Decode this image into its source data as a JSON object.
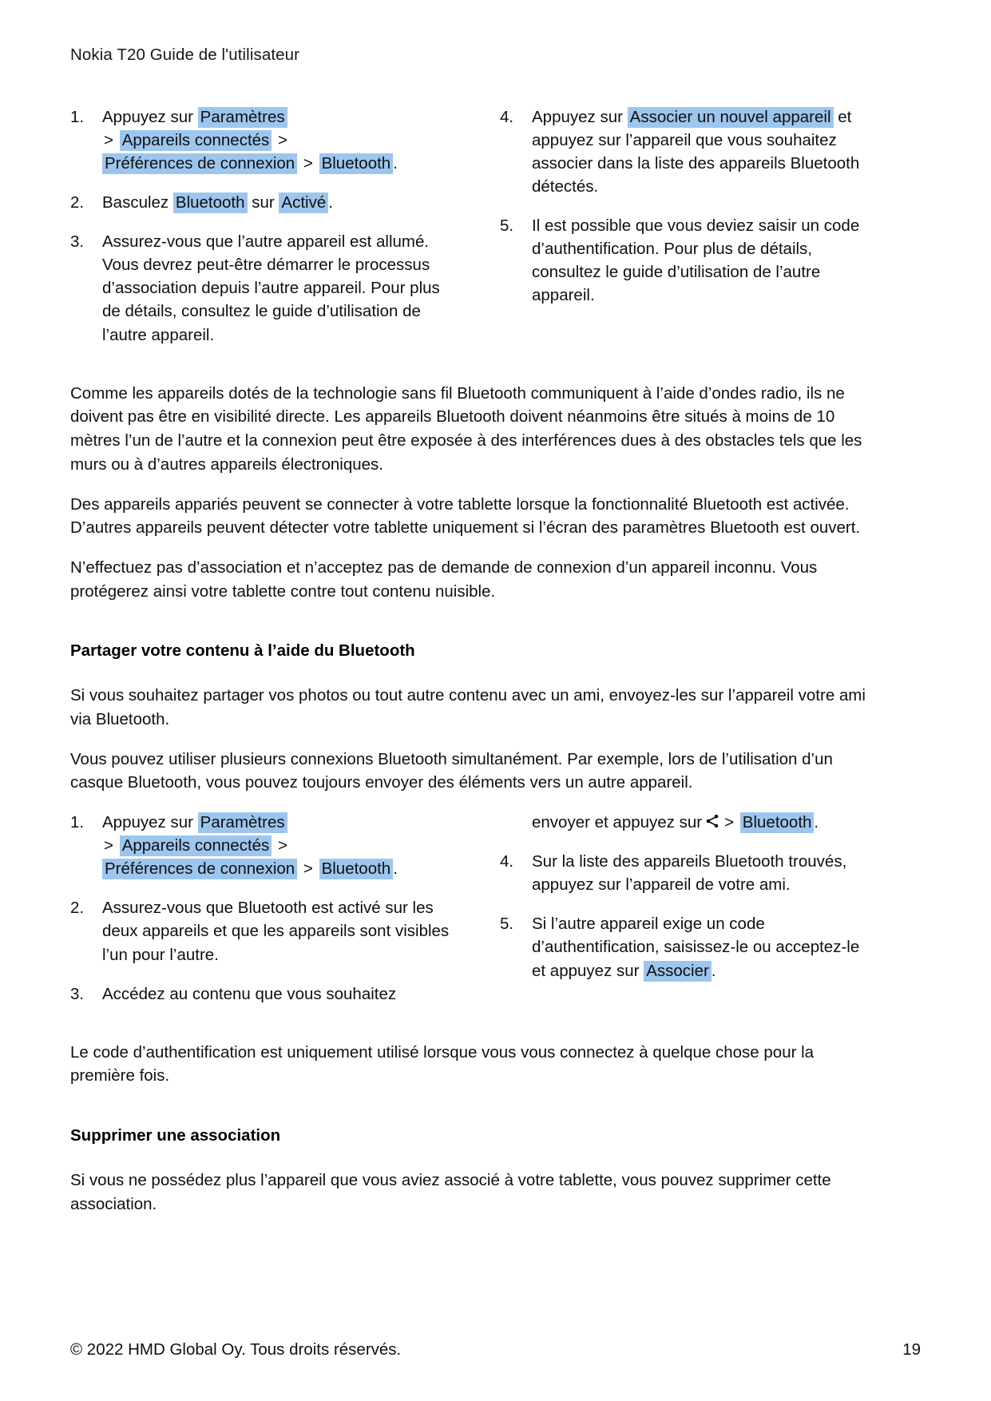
{
  "header": {
    "title": "Nokia T20 Guide de l'utilisateur"
  },
  "highlight_color": "#9dc6ee",
  "pairing_list": {
    "left": {
      "step1": {
        "num": "1.",
        "lead": "Appuyez sur",
        "ui_settings": "Paramètres",
        "sep1": ">",
        "ui_connected_devices": "Appareils connectés",
        "sep2": ">",
        "ui_connection_prefs": "Préférences de connexion",
        "sep3": ">",
        "ui_bluetooth": "Bluetooth",
        "period": "."
      },
      "step2": {
        "num": "2.",
        "lead": "Basculez",
        "ui_bluetooth": "Bluetooth",
        "mid": "sur",
        "ui_on": "Activé",
        "period": "."
      },
      "step3": {
        "num": "3.",
        "text": "Assurez-vous que l’autre appareil est allumé. Vous devrez peut-être démarrer le processus d’association depuis l’autre appareil. Pour plus de détails, consultez le guide d’utilisation de l’autre appareil."
      }
    },
    "right": {
      "step4": {
        "num": "4.",
        "lead": "Appuyez sur",
        "ui_pair_new_device": "Associer un nouvel appareil",
        "tail": "et appuyez sur l’appareil que vous souhaitez associer dans la liste des appareils Bluetooth détectés."
      },
      "step5": {
        "num": "5.",
        "text": "Il est possible que vous deviez saisir un code d’authentification. Pour plus de détails, consultez le guide d’utilisation de l’autre appareil."
      }
    }
  },
  "paragraphs": {
    "p1": "Comme les appareils dotés de la technologie sans fil Bluetooth communiquent à l’aide d’ondes radio, ils ne doivent pas être en visibilité directe. Les appareils Bluetooth doivent néanmoins être situés à moins de 10 mètres l’un de l’autre et la connexion peut être exposée à des interférences dues à des obstacles tels que les murs ou à d’autres appareils électroniques.",
    "p2": "Des appareils appariés peuvent se connecter à votre tablette lorsque la fonctionnalité Bluetooth est activée. D’autres appareils peuvent détecter votre tablette uniquement si l’écran des paramètres Bluetooth est ouvert.",
    "p3": "N’effectuez pas d’association et n’acceptez pas de demande de connexion d’un appareil inconnu. Vous protégerez ainsi votre tablette contre tout contenu nuisible."
  },
  "share_section": {
    "heading": "Partager votre contenu à l’aide du Bluetooth",
    "intro1": "Si vous souhaitez partager vos photos ou tout autre contenu avec un ami, envoyez-les sur l’appareil votre ami via Bluetooth.",
    "intro2": "Vous pouvez utiliser plusieurs connexions Bluetooth simultanément. Par exemple, lors de l’utilisation d’un casque Bluetooth, vous pouvez toujours envoyer des éléments vers un autre appareil.",
    "left": {
      "step1": {
        "num": "1.",
        "lead": "Appuyez sur",
        "ui_settings": "Paramètres",
        "sep1": ">",
        "ui_connected_devices": "Appareils connectés",
        "sep2": ">",
        "ui_connection_prefs": "Préférences de connexion",
        "sep3": ">",
        "ui_bluetooth": "Bluetooth",
        "period": "."
      },
      "step2": {
        "num": "2.",
        "text": "Assurez-vous que Bluetooth est activé sur les deux appareils et que les appareils sont visibles l’un pour l’autre."
      },
      "step3": {
        "num": "3.",
        "text": "Accédez au contenu que vous souhaitez"
      }
    },
    "right": {
      "continuation": {
        "lead": "envoyer et appuyez sur",
        "icon": "share-icon",
        "sep": ">",
        "ui_bluetooth": "Bluetooth",
        "period": "."
      },
      "step4": {
        "num": "4.",
        "text": "Sur la liste des appareils Bluetooth trouvés, appuyez sur l’appareil de votre ami."
      },
      "step5": {
        "num": "5.",
        "lead": "Si l’autre appareil exige un code d’authentification, saisissez-le ou acceptez-le et appuyez sur",
        "ui_pair": "Associer",
        "period": "."
      }
    },
    "closing": "Le code d’authentification est uniquement utilisé lorsque vous vous connectez à quelque chose pour la première fois."
  },
  "unpair_section": {
    "heading": "Supprimer une association",
    "text": "Si vous ne possédez plus l’appareil que vous aviez associé à votre tablette, vous pouvez supprimer cette association."
  },
  "footer": {
    "copyright": "© 2022 HMD Global Oy. Tous droits réservés.",
    "page_number": "19"
  }
}
